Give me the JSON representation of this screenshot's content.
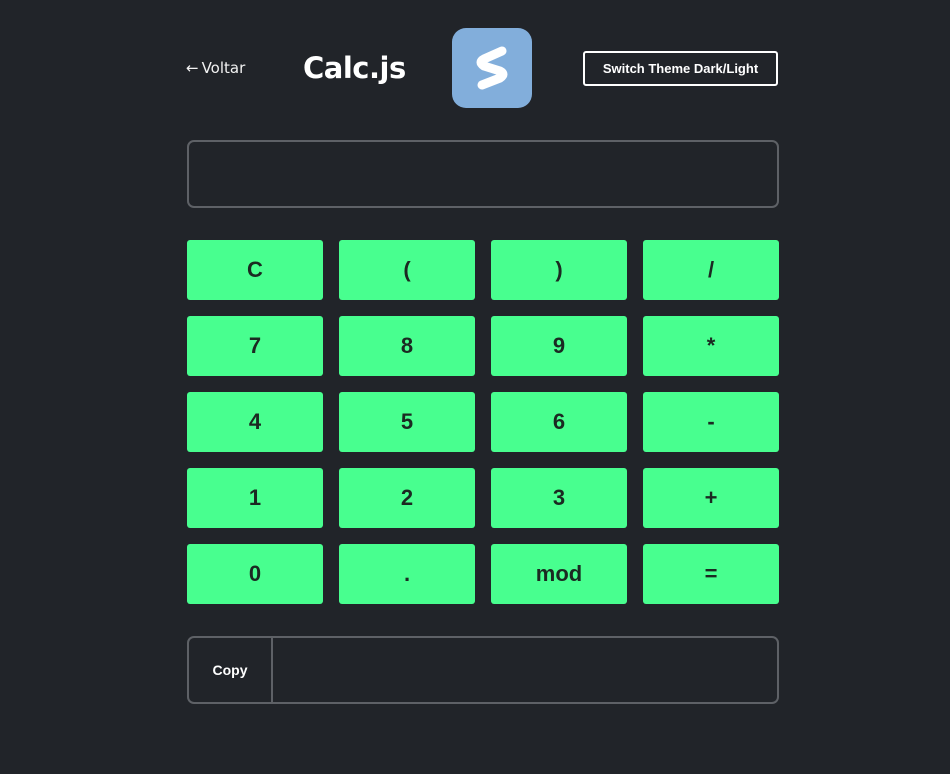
{
  "header": {
    "back_arrow": "←",
    "back_label": "Voltar",
    "title": "Calc.js",
    "logo_icon": "s-logo-icon",
    "theme_button_label": "Switch Theme Dark/Light"
  },
  "display": {
    "value": "",
    "placeholder": ""
  },
  "keypad": {
    "keys": [
      "C",
      "(",
      ")",
      "/",
      "7",
      "8",
      "9",
      "*",
      "4",
      "5",
      "6",
      "-",
      "1",
      "2",
      "3",
      "+",
      "0",
      ".",
      "mod",
      "="
    ]
  },
  "result": {
    "copy_label": "Copy",
    "value": ""
  },
  "colors": {
    "background": "#212429",
    "key_background": "#48ff8f",
    "key_text": "#1b2a22",
    "logo_background": "#82aedb",
    "border": "#5e6166"
  }
}
